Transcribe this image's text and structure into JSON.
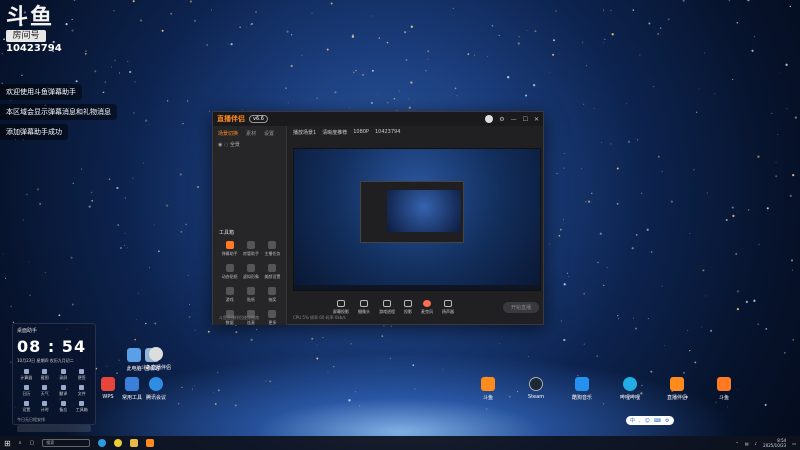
{
  "room": {
    "logo": "斗鱼",
    "label": "房间号",
    "number": "10423794"
  },
  "messages": [
    "欢迎使用斗鱼弹幕助手",
    "本区域会显示弹幕消息和礼物消息",
    "添加弹幕助手成功"
  ],
  "app": {
    "logo": "直播伴侣",
    "version": "v6.6",
    "side_tabs": [
      "场景切换",
      "素材",
      "设置"
    ],
    "scene_label": "全景",
    "tools_title": "工具箱",
    "tools": [
      "弹幕助手",
      "房管助手",
      "主播任务",
      "动态贴纸",
      "虚拟形象",
      "美颜设置",
      "游戏",
      "贴纸",
      "抽奖",
      "数据",
      "连麦",
      "更多"
    ],
    "side_footer": "斗鱼直播伴侣使用指南",
    "scene_name": "播放场景1",
    "scene_tags": [
      "清晰度推荐",
      "1080P",
      "10423794"
    ],
    "bottom_tools": [
      "屏幕投影",
      "摄像头",
      "游戏进程",
      "投影",
      "麦克风",
      "扬声器"
    ],
    "start_live": "开始直播",
    "status": "CPU 5%  帧率 60  码率 0kb/s"
  },
  "desktop_icons": [
    {
      "label": "此电脑",
      "color": "#5aa0e8"
    },
    {
      "label": "回收站",
      "color": "#8fb6d8"
    },
    {
      "label": "斗鱼直播伴侣",
      "color": "#dddddd"
    },
    {
      "label": "WPS",
      "color": "#e8443a"
    },
    {
      "label": "常用工具",
      "color": "#3c7fd8"
    },
    {
      "label": "腾讯会议",
      "color": "#2f8de4"
    },
    {
      "label": "斗鱼",
      "color": "#ff8a1e"
    },
    {
      "label": "Steam",
      "color": "#1b2838"
    },
    {
      "label": "酷狗音乐",
      "color": "#2490f0"
    },
    {
      "label": "哔哩哔哩",
      "color": "#23ade5"
    },
    {
      "label": "直播伴侣",
      "color": "#ff8a1e"
    },
    {
      "label": "斗鱼",
      "color": "#ff7a22"
    }
  ],
  "widget": {
    "title": "桌面助手",
    "time": "08 : 54",
    "date": "10月23日 星期四  农历九月初二",
    "items": [
      "计算器",
      "截图",
      "录屏",
      "便签",
      "日历",
      "天气",
      "翻译",
      "文件",
      "设置",
      "计时",
      "备忘",
      "工具箱"
    ],
    "footer": "今日无日程安排"
  },
  "taskbar": {
    "search": "搜索",
    "time": "8:54",
    "date": "2025/10/23"
  },
  "ime": {
    "label": "中"
  }
}
